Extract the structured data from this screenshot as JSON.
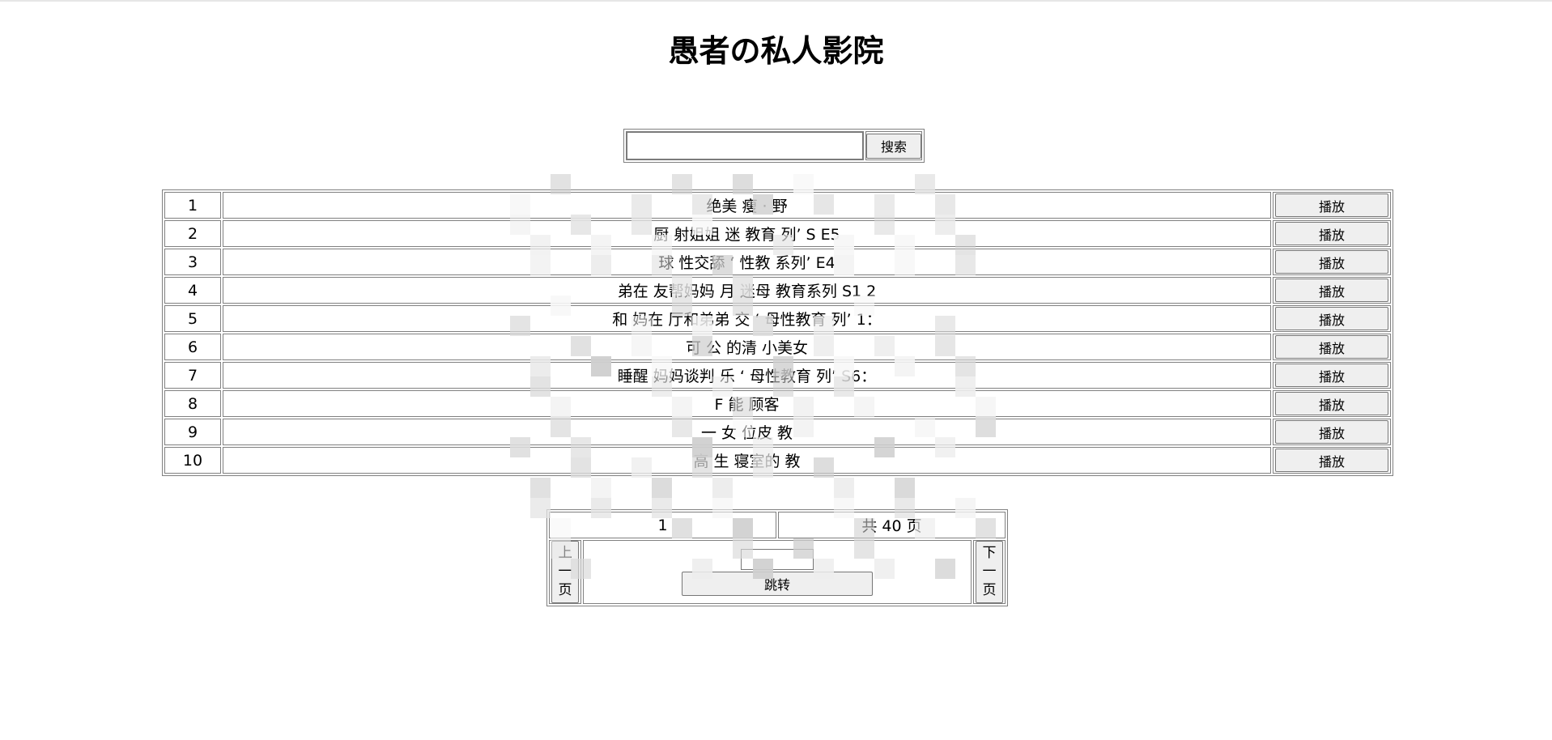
{
  "page": {
    "title": "愚者の私人影院"
  },
  "search": {
    "input_value": "",
    "button_label": "搜索"
  },
  "list": {
    "rows": [
      {
        "index": "1",
        "title": "绝美  瘦 ·  野",
        "action": "播放"
      },
      {
        "index": "2",
        "title": "厨  射姐姐  迷  教育  列’  S  E5",
        "action": "播放"
      },
      {
        "index": "3",
        "title": "球  性交舔  ‘  性教  系列’    E4",
        "action": "播放"
      },
      {
        "index": "4",
        "title": "弟在  友帮妈妈  月  迷母  教育系列  S1  2",
        "action": "播放"
      },
      {
        "index": "5",
        "title": "和  妈在  厅和弟弟  交  ‘  母性教育  列’  1：",
        "action": "播放"
      },
      {
        "index": "6",
        "title": "可  公  的清  小美女",
        "action": "播放"
      },
      {
        "index": "7",
        "title": "睡醒  妈妈谈判  乐  ‘  母性教育  列’  S6：",
        "action": "播放"
      },
      {
        "index": "8",
        "title": "F  能  顾客  ",
        "action": "播放"
      },
      {
        "index": "9",
        "title": "  一  女  位皮  教",
        "action": "播放"
      },
      {
        "index": "10",
        "title": "高  生  寝室的  教",
        "action": "播放"
      }
    ]
  },
  "pager": {
    "current_page": "1",
    "total_text": "共 40  页",
    "prev_chars": [
      "上",
      "一",
      "页"
    ],
    "next_chars": [
      "下",
      "一",
      "页"
    ],
    "jump_input_value": "",
    "jump_label": "跳转"
  }
}
